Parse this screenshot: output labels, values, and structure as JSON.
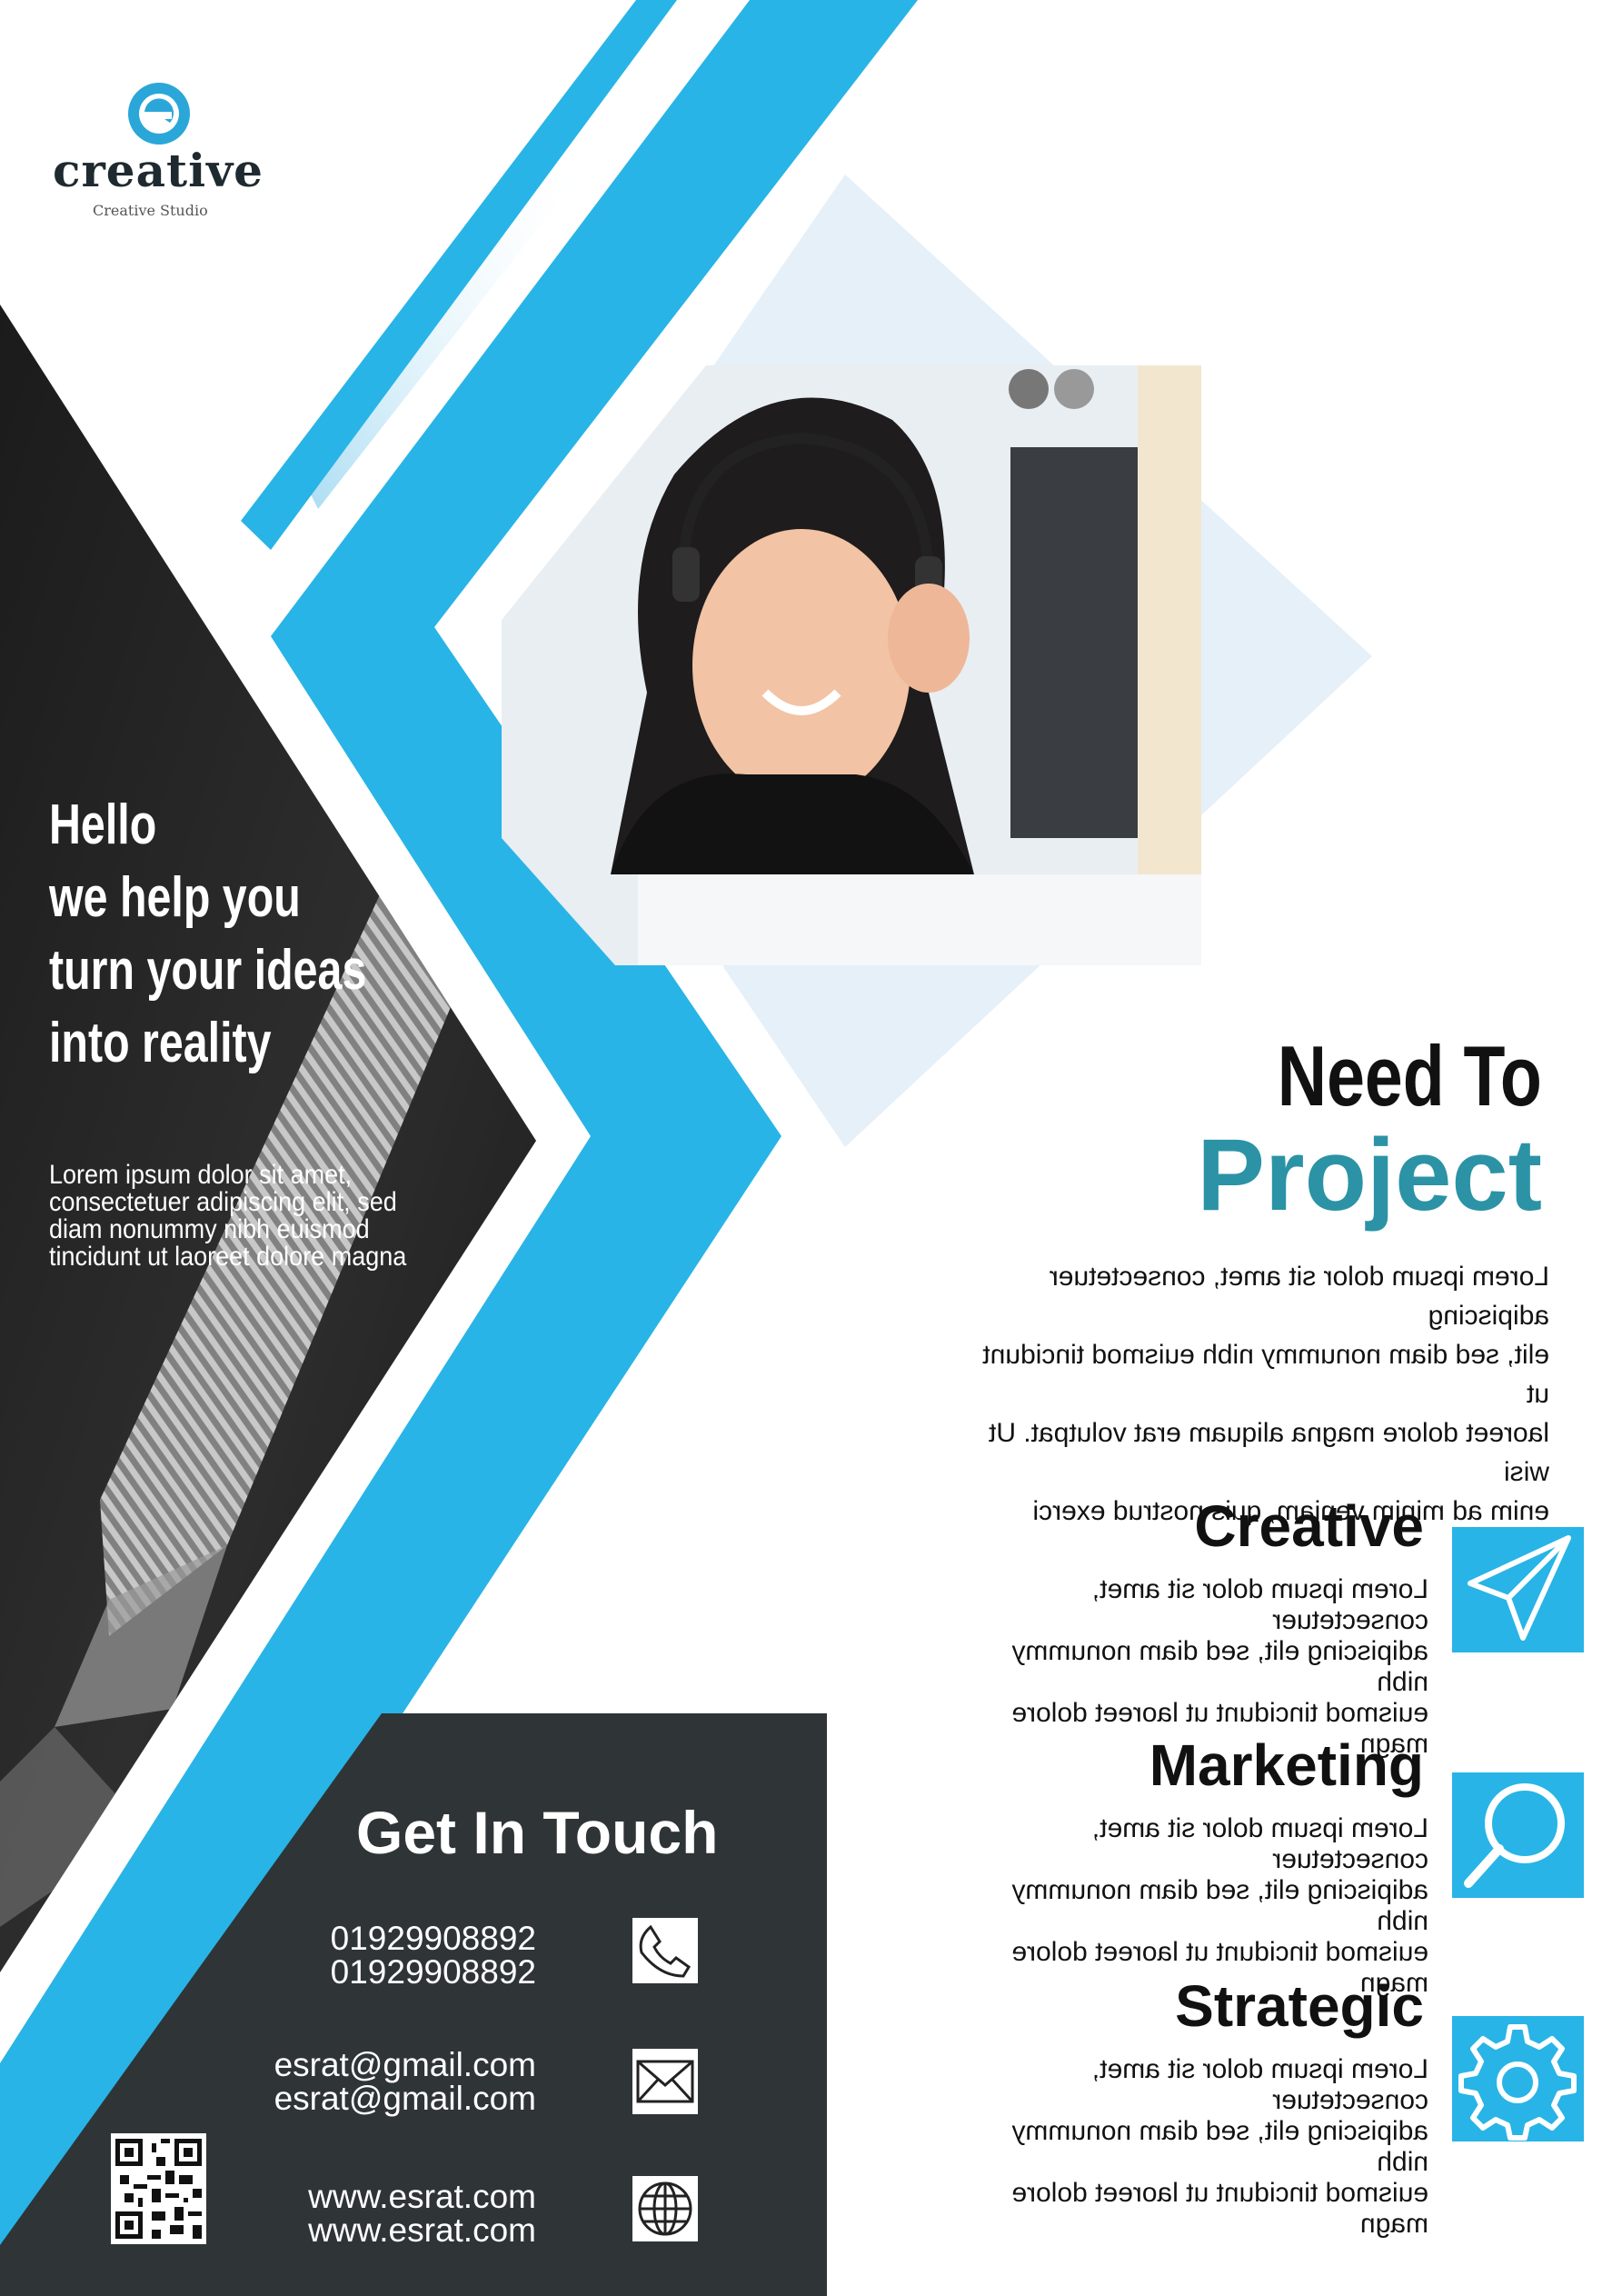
{
  "logo": {
    "name": "creative",
    "tagline": "Creative Studio"
  },
  "hero": {
    "headline": [
      "Hello",
      "we help you",
      "turn your ideas",
      "into reality"
    ],
    "body": [
      "Lorem ipsum dolor sit amet,",
      "consectetuer adipiscing elit, sed",
      "diam nonummy nibh euismod",
      "tincidunt ut laoreet dolore magna"
    ]
  },
  "project": {
    "heading": "Need To",
    "highlight": "Project",
    "body": [
      "Lorem ipsum dolor sit amet, consectetuer adipiscing",
      "elit, sed diam nonummy nibh euismod tincidunt ut",
      "laoreet dolore magna aliquam erat volutpat. Ut wisi",
      "enim ad minim veniam, quis nostrud exerci tation"
    ]
  },
  "services": [
    {
      "title": "Creative",
      "icon": "paper-plane-icon",
      "body": [
        "Lorem ipsum dolor sit amet, consectetuer",
        "adipiscing elit, sed diam nonummy nibh",
        "euismod tincidunt ut laoreet dolore magn"
      ]
    },
    {
      "title": "Marketing",
      "icon": "magnifier-icon",
      "body": [
        "Lorem ipsum dolor sit amet, consectetuer",
        "adipiscing elit, sed diam nonummy nibh",
        "euismod tincidunt ut laoreet dolore magn"
      ]
    },
    {
      "title": "Strategic",
      "icon": "gear-icon",
      "body": [
        "Lorem ipsum dolor sit amet, consectetuer",
        "adipiscing elit, sed diam nonummy nibh",
        "euismod tincidunt ut laoreet dolore magn"
      ]
    }
  ],
  "contact": {
    "title": "Get In Touch",
    "phones": [
      "01929908892",
      "01929908892"
    ],
    "emails": [
      "esrat@gmail.com",
      "esrat@gmail.com"
    ],
    "websites": [
      "www.esrat.com",
      "www.esrat.com"
    ]
  },
  "colors": {
    "accent": "#28b4e6",
    "highlight": "#2b93a5",
    "dark_panel": "#2f3437",
    "pale_diamond": "#e6f0f9"
  }
}
